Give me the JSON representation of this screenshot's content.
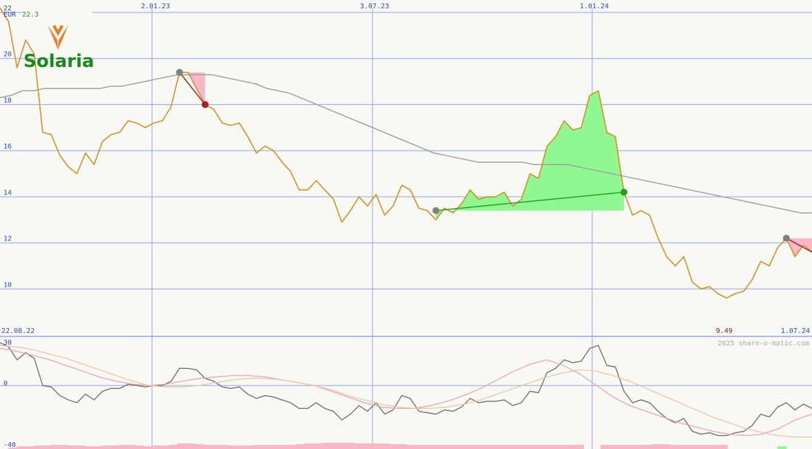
{
  "header": {
    "currency": "EUR",
    "last_price": "22.3"
  },
  "logo": {
    "brand": "Solaria"
  },
  "watermark": "2025 share-o-matic.com",
  "colors": {
    "price": "#d4901a",
    "sma": "#a0a0a0",
    "grid": "#8fa4ee",
    "bg": "#f8f8f4",
    "gain_fill": "#90f890",
    "loss_fill": "#f8b8c8",
    "gain_line": "#22a022",
    "loss_line": "#a02020",
    "logo_green": "#1a8a1a",
    "logo_orange": "#f07a20"
  },
  "chart_data": [
    {
      "type": "line",
      "panel": "price",
      "x_tick_labels": [
        "22.08.22",
        "2.01.23",
        "3.07.23",
        "1.01.24",
        "1.07.24"
      ],
      "y_ticks": [
        10,
        12,
        14,
        16,
        18,
        20,
        22
      ],
      "ylim": [
        8.0,
        22.3
      ],
      "min_label": "9.49",
      "series": [
        {
          "key": "price",
          "values": [
            22.2,
            21.6,
            19.6,
            20.8,
            20.2,
            16.8,
            16.7,
            15.8,
            15.3,
            15.0,
            15.9,
            15.4,
            16.4,
            16.7,
            16.8,
            17.3,
            17.2,
            17.0,
            17.2,
            17.3,
            17.9,
            19.4,
            19.4,
            18.7,
            18.0,
            17.8,
            17.2,
            17.1,
            17.2,
            16.6,
            15.9,
            16.2,
            16.0,
            15.5,
            15.1,
            14.3,
            14.3,
            14.7,
            14.3,
            13.9,
            12.9,
            13.4,
            14.0,
            13.6,
            14.1,
            13.2,
            13.6,
            14.5,
            14.3,
            13.5,
            13.4,
            13.0,
            13.5,
            13.3,
            13.7,
            14.3,
            13.9,
            14.0,
            14.0,
            14.2,
            13.6,
            13.9,
            15.0,
            14.8,
            16.2,
            16.6,
            17.3,
            16.9,
            17.0,
            18.4,
            18.6,
            16.8,
            16.6,
            14.2,
            13.2,
            13.4,
            13.2,
            12.2,
            11.4,
            11.0,
            11.4,
            10.3,
            10.0,
            10.1,
            9.8,
            9.6,
            9.8,
            9.9,
            10.4,
            11.2,
            11.0,
            11.8,
            12.2,
            11.4,
            11.9,
            11.6
          ],
          "sma": [
            18.3,
            18.4,
            18.6,
            18.6,
            18.7,
            18.7,
            18.7,
            18.7,
            18.7,
            18.7,
            18.8,
            18.8,
            18.9,
            19.0,
            19.1,
            19.2,
            19.3,
            19.3,
            19.3,
            19.3,
            19.2,
            19.1,
            19.0,
            18.9,
            18.7,
            18.6,
            18.5,
            18.3,
            18.1,
            17.9,
            17.7,
            17.5,
            17.3,
            17.1,
            16.9,
            16.7,
            16.5,
            16.3,
            16.1,
            15.9,
            15.8,
            15.7,
            15.6,
            15.5,
            15.5,
            15.5,
            15.5,
            15.5,
            15.4,
            15.4,
            15.4,
            15.4,
            15.3,
            15.2,
            15.1,
            15.0,
            14.9,
            14.8,
            14.7,
            14.6,
            14.5,
            14.4,
            14.3,
            14.2,
            14.1,
            14.0,
            13.9,
            13.8,
            13.7,
            13.6,
            13.5,
            13.4,
            13.3,
            13.3
          ]
        }
      ],
      "trades": [
        {
          "entry": 19.4,
          "exit": 18.0,
          "result": "loss"
        },
        {
          "entry": 13.4,
          "exit": 14.2,
          "result": "gain"
        },
        {
          "entry": 12.2,
          "exit": null,
          "result": "loss"
        }
      ]
    },
    {
      "type": "line",
      "panel": "oscillator",
      "y_ticks": [
        30,
        0,
        -40
      ],
      "ylim": [
        -40,
        30
      ],
      "series": [
        {
          "key": "momentum",
          "values": [
            30,
            27,
            18,
            23,
            19,
            0,
            -1,
            -7,
            -10,
            -12,
            -6,
            -10,
            -4,
            -2,
            -2,
            1,
            0,
            -1,
            0,
            0,
            3,
            12,
            12,
            11,
            5,
            3,
            -1,
            -2,
            -1,
            -6,
            -9,
            -7,
            -8,
            -10,
            -12,
            -16,
            -16,
            -12,
            -16,
            -18,
            -24,
            -20,
            -14,
            -18,
            -12,
            -20,
            -17,
            -7,
            -9,
            -18,
            -19,
            -20,
            -17,
            -18,
            -15,
            -9,
            -12,
            -11,
            -11,
            -10,
            -14,
            -12,
            -4,
            -5,
            9,
            12,
            18,
            16,
            17,
            26,
            28,
            14,
            13,
            -4,
            -12,
            -10,
            -12,
            -18,
            -23,
            -26,
            -23,
            -32,
            -34,
            -33,
            -35,
            -35,
            -33,
            -32,
            -28,
            -20,
            -22,
            -15,
            -12,
            -17,
            -13,
            -16
          ]
        },
        {
          "key": "signal_1",
          "values": [
            26,
            24,
            21,
            18,
            14,
            10,
            6,
            3,
            1,
            0,
            1,
            3,
            5,
            6,
            7,
            7,
            6,
            4,
            2,
            0,
            -4,
            -8,
            -12,
            -15,
            -16,
            -16,
            -14,
            -11,
            -7,
            -2,
            4,
            10,
            15,
            18,
            14,
            8,
            0,
            -8,
            -14,
            -18,
            -22,
            -26,
            -29,
            -32,
            -34,
            -35,
            -34,
            -30,
            -24,
            -20
          ]
        },
        {
          "key": "signal_2",
          "values": [
            28,
            27,
            25,
            22,
            19,
            15,
            11,
            7,
            3,
            0,
            -1,
            -1,
            0,
            2,
            4,
            5,
            5,
            4,
            2,
            0,
            -3,
            -7,
            -10,
            -13,
            -15,
            -16,
            -16,
            -15,
            -13,
            -10,
            -6,
            -2,
            2,
            6,
            9,
            11,
            10,
            7,
            3,
            -2,
            -7,
            -12,
            -17,
            -22,
            -26,
            -30,
            -33,
            -35,
            -36,
            -36
          ]
        }
      ]
    }
  ]
}
